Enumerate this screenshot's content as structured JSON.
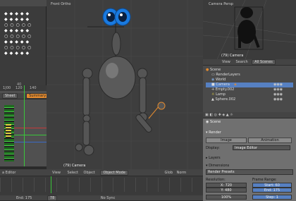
{
  "topleft": {
    "axis_label": "40"
  },
  "timeline": {
    "axis": [
      "1|00",
      "120",
      "140"
    ],
    "tab_sheet": "Sheet",
    "tab_summary": "Summary"
  },
  "view3d": {
    "title": "Front Ortho",
    "status": "(79) Camera",
    "header": {
      "editor": "a Editor",
      "view": "View",
      "select": "Select",
      "object": "Object",
      "mode": "Object Mode",
      "global": "Glob",
      "shading": "Norm"
    }
  },
  "cam_view": {
    "title": "Camera Persp",
    "status": "(79) Camera"
  },
  "outliner": {
    "view": "View",
    "search": "Search",
    "filter": "All Scenes",
    "items": [
      {
        "name": "Scene"
      },
      {
        "name": "RenderLayers"
      },
      {
        "name": "World"
      },
      {
        "name": "Camera"
      },
      {
        "name": "Empty.002"
      },
      {
        "name": "Lamp"
      },
      {
        "name": "Sphere.002"
      }
    ]
  },
  "properties": {
    "scene": "Scene",
    "render_section": "Render",
    "btn_image": "Image",
    "btn_animation": "Animation",
    "display_label": "Display:",
    "display_value": "Image Editor",
    "layers": "Layers",
    "dimensions": "Dimensions",
    "presets": "Render Presets",
    "resolution": "Resolution:",
    "frame_range": "Frame Range:",
    "x": "X: 720",
    "y": "Y: 480",
    "start": "Start: 60",
    "end": "End: 175",
    "percent": "100%",
    "step": "Step: 1"
  },
  "bottom": {
    "end_label": "End: 175",
    "frame": "78",
    "sync": "No Sync"
  },
  "colors": {
    "accent": "#e28a2f",
    "selected": "#5680c2",
    "bg": "#2a2a2a"
  }
}
